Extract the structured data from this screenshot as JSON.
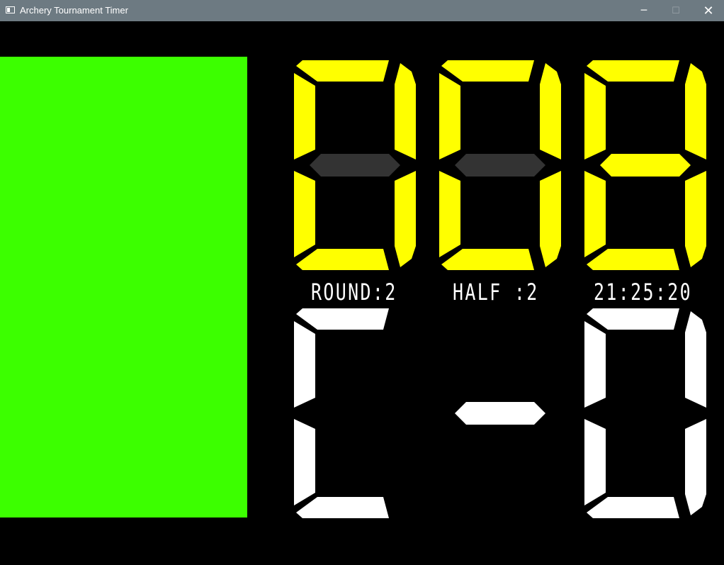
{
  "window": {
    "title": "Archery Tournament Timer",
    "minimize_glyph": "─",
    "maximize_glyph": "☐",
    "close_glyph": "✕"
  },
  "status_panel": {
    "color": "#3cff00"
  },
  "countdown": {
    "digits": [
      "0",
      "0",
      "8"
    ],
    "value": "008",
    "on_color": "#ffff00",
    "off_color": "#333333"
  },
  "info": {
    "round_label": "ROUND:2",
    "half_label": "HALF :2",
    "clock": "21:25:20"
  },
  "group": {
    "characters": [
      "C",
      "-",
      "D"
    ],
    "color": "#ffffff"
  }
}
